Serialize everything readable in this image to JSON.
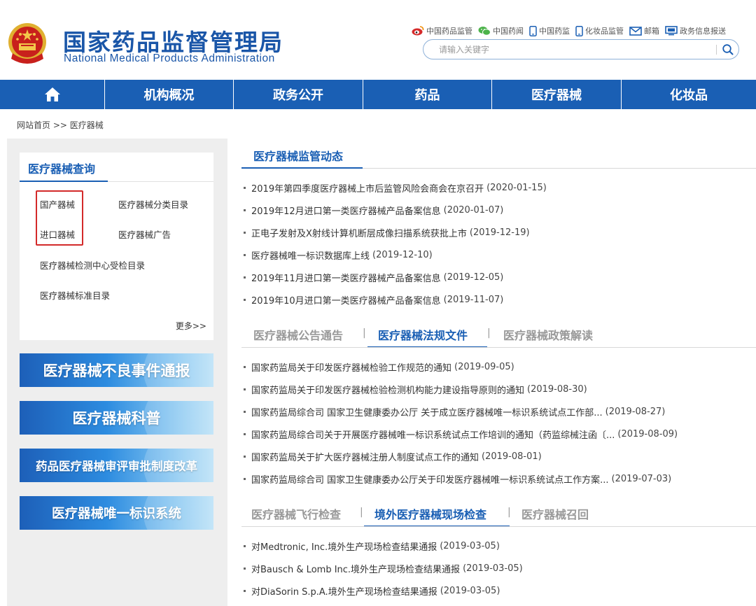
{
  "header": {
    "title": "国家药品监督管理局",
    "subtitle": "National Medical Products Administration",
    "toplinks": [
      {
        "label": "中国药品监管",
        "icon": "weibo-icon"
      },
      {
        "label": "中国药闻",
        "icon": "wechat-icon"
      },
      {
        "label": "中国药监",
        "icon": "mobile-icon"
      },
      {
        "label": "化妆品监管",
        "icon": "mobile-icon"
      },
      {
        "label": "邮箱",
        "icon": "mail-icon"
      },
      {
        "label": "政务信息报送",
        "icon": "monitor-icon"
      }
    ],
    "search_placeholder": "请输入关键字"
  },
  "nav": {
    "items": [
      "机构概况",
      "政务公开",
      "药品",
      "医疗器械",
      "化妆品"
    ]
  },
  "breadcrumb": {
    "home": "网站首页",
    "sep": ">>",
    "current": "医疗器械"
  },
  "left": {
    "query_title": "医疗器械查询",
    "links": {
      "domestic": "国产器械",
      "classification": "医疗器械分类目录",
      "imported": "进口器械",
      "advert": "医疗器械广告",
      "testing": "医疗器械检测中心受检目录",
      "standard": "医疗器械标准目录"
    },
    "more": "更多>>",
    "banners": [
      "医疗器械不良事件通报",
      "医疗器械科普",
      "药品医疗器械审评审批制度改革",
      "医疗器械唯一标识系统"
    ]
  },
  "right": {
    "section1_title": "医疗器械监管动态",
    "news1": [
      {
        "title": "2019年第四季度医疗器械上市后监管风险会商会在京召开",
        "date": "(2020-01-15)"
      },
      {
        "title": "2019年12月进口第一类医疗器械产品备案信息",
        "date": "(2020-01-07)"
      },
      {
        "title": "正电子发射及X射线计算机断层成像扫描系统获批上市",
        "date": "(2019-12-19)"
      },
      {
        "title": "医疗器械唯一标识数据库上线",
        "date": "(2019-12-10)"
      },
      {
        "title": "2019年11月进口第一类医疗器械产品备案信息",
        "date": "(2019-12-05)"
      },
      {
        "title": "2019年10月进口第一类医疗器械产品备案信息",
        "date": "(2019-11-07)"
      }
    ],
    "tabs2": [
      "医疗器械公告通告",
      "医疗器械法规文件",
      "医疗器械政策解读"
    ],
    "news2": [
      {
        "title": "国家药监局关于印发医疗器械检验工作规范的通知",
        "date": "(2019-09-05)"
      },
      {
        "title": "国家药监局关于印发医疗器械检验检测机构能力建设指导原则的通知",
        "date": "(2019-08-30)"
      },
      {
        "title": "国家药监局综合司 国家卫生健康委办公厅 关于成立医疗器械唯一标识系统试点工作部...",
        "date": "(2019-08-27)"
      },
      {
        "title": "国家药监局综合司关于开展医疗器械唯一标识系统试点工作培训的通知（药监综械注函〔...",
        "date": "(2019-08-09)"
      },
      {
        "title": "国家药监局关于扩大医疗器械注册人制度试点工作的通知",
        "date": "(2019-08-01)"
      },
      {
        "title": "国家药监局综合司 国家卫生健康委办公厅关于印发医疗器械唯一标识系统试点工作方案...",
        "date": "(2019-07-03)"
      }
    ],
    "tabs3": [
      "医疗器械飞行检查",
      "境外医疗器械现场检查",
      "医疗器械召回"
    ],
    "news3": [
      {
        "title": "对Medtronic, Inc.境外生产现场检查结果通报",
        "date": "(2019-03-05)"
      },
      {
        "title": "对Bausch & Lomb Inc.境外生产现场检查结果通报",
        "date": "(2019-03-05)"
      },
      {
        "title": "对DiaSorin S.p.A.境外生产现场检查结果通报",
        "date": "(2019-03-05)"
      }
    ]
  },
  "colors": {
    "brand_blue": "#1a5fb4",
    "highlight_red": "#d32a2a"
  }
}
